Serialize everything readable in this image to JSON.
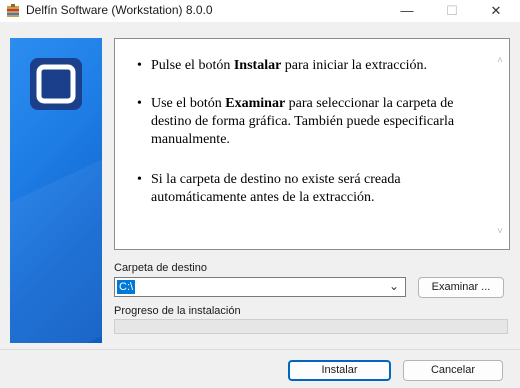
{
  "window": {
    "title": "Delfín Software (Workstation) 8.0.0",
    "icon": "installer-icon",
    "controls": {
      "minimize": "—",
      "maximize": "☐",
      "close": "✕"
    }
  },
  "banner": {
    "logo": "square-logo-icon",
    "accent": "#1f7ee6"
  },
  "instructions": {
    "bullets": [
      {
        "pre": "Pulse el botón ",
        "bold": "Instalar",
        "post": " para iniciar la extracción."
      },
      {
        "pre": "Use el botón ",
        "bold": "Examinar",
        "post": " para seleccionar la carpeta de destino de forma gráfica. También puede especificarla manualmente."
      },
      {
        "pre": "Si la carpeta de destino no existe será creada automáticamente antes de la extracción.",
        "bold": "",
        "post": ""
      }
    ],
    "bullet_char": "•"
  },
  "destination": {
    "label": "Carpeta de destino",
    "value": "C:\\",
    "browse_label": "Examinar ..."
  },
  "progress": {
    "label": "Progreso de la instalación",
    "value": 0,
    "fill_color": "#06b025"
  },
  "footer": {
    "install_label": "Instalar",
    "cancel_label": "Cancelar"
  }
}
